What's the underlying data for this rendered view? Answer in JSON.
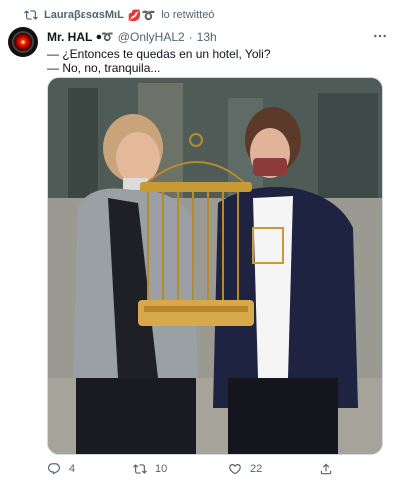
{
  "retweet": {
    "user": "LauraβεsαsMιL",
    "emoji": "💋➰",
    "label": "lo retwitteó"
  },
  "tweet": {
    "author_name": "Mr. HAL",
    "name_deco": "⏺➰",
    "handle": "@OnlyHAL2",
    "separator": "·",
    "time": "13h",
    "lines": [
      "— ¿Entonces te quedas en un hotel, Yoli?",
      "— No, no, tranquila..."
    ]
  },
  "stats": {
    "replies": "4",
    "retweets": "10",
    "likes": "22"
  },
  "icons": {
    "retweet": "retweet-icon",
    "more": "more-icon",
    "reply": "reply-icon",
    "like": "heart-icon",
    "share": "share-icon"
  },
  "colors": {
    "text_primary": "#0f1419",
    "text_secondary": "#536471",
    "border": "#cfd9de"
  }
}
